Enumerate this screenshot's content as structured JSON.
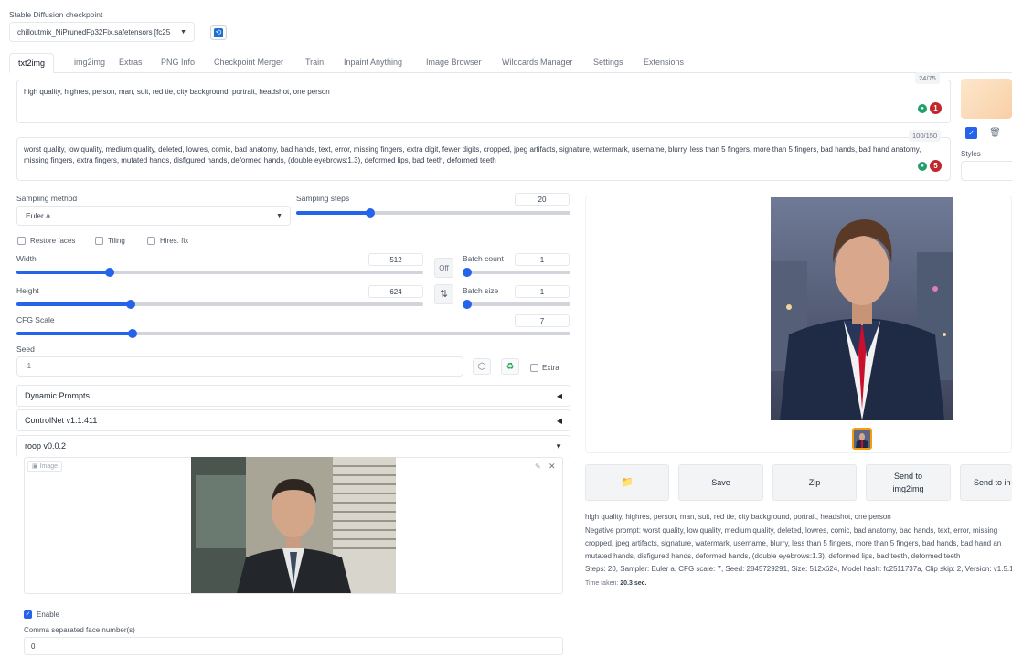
{
  "checkpoint": {
    "label": "Stable Diffusion checkpoint",
    "value": "chilloutmix_NiPrunedFp32Fix.safetensors [fc25"
  },
  "tabs": [
    "txt2img",
    "img2img",
    "Extras",
    "PNG Info",
    "Checkpoint Merger",
    "Train",
    "Inpaint Anything",
    "Image Browser",
    "Wildcards Manager",
    "Settings",
    "Extensions"
  ],
  "prompt": {
    "text": "high quality, highres, person, man, suit, red tie, city background, portrait, headshot, one person",
    "counter": "24/75",
    "badge": "1"
  },
  "negative_prompt": {
    "line1": "worst quality, low quality, medium quality, deleted, lowres, comic, bad anatomy, bad hands, text, error, missing fingers, extra digit, fewer digits, cropped, jpeg artifacts, signature, watermark, username, blurry, less than 5 fingers, more than 5 fingers, bad hands, bad hand anatomy,",
    "line2": "missing fingers, extra fingers, mutated hands, disfigured hands, deformed hands, (double eyebrows:1.3), deformed lips, bad teeth, deformed teeth",
    "counter": "100/150",
    "badge": "5"
  },
  "styles_label": "Styles",
  "sampling": {
    "method_label": "Sampling method",
    "method_value": "Euler a",
    "steps_label": "Sampling steps",
    "steps_value": "20",
    "steps_fraction": 0.27
  },
  "options": {
    "restore_faces": "Restore faces",
    "tiling": "Tiling",
    "hires_fix": "Hires. fix"
  },
  "size": {
    "width_label": "Width",
    "width_value": "512",
    "width_fraction": 0.23,
    "height_label": "Height",
    "height_value": "624",
    "height_fraction": 0.28,
    "off_label": "Off",
    "swap_icon": "⇅"
  },
  "batch": {
    "count_label": "Batch count",
    "count_value": "1",
    "size_label": "Batch size",
    "size_value": "1"
  },
  "cfg": {
    "label": "CFG Scale",
    "value": "7",
    "fraction": 0.21
  },
  "seed": {
    "label": "Seed",
    "value": "-1",
    "extra_label": "Extra"
  },
  "accordions": {
    "dynamic_prompts": "Dynamic Prompts",
    "controlnet": "ControlNet v1.1.411",
    "roop": "roop v0.0.2"
  },
  "roop": {
    "image_label": "Image",
    "enable_label": "Enable",
    "faces_label": "Comma separated face number(s)",
    "faces_value": "0"
  },
  "actions": {
    "save": "Save",
    "zip": "Zip",
    "send_img2img_line1": "Send to",
    "send_img2img_line2": "img2img",
    "send_inpaint": "Send to in"
  },
  "info": {
    "prompt": "high quality, highres, person, man, suit, red tie, city background, portrait, headshot, one person",
    "negative_line1": "Negative prompt: worst quality, low quality, medium quality, deleted, lowres, comic, bad anatomy, bad hands, text, error, missing",
    "negative_line2": "cropped, jpeg artifacts, signature, watermark, username, blurry, less than 5 fingers, more than 5 fingers, bad hands, bad hand an",
    "negative_line3": "mutated hands, disfigured hands, deformed hands, (double eyebrows:1.3), deformed lips, bad teeth, deformed teeth",
    "params": "Steps: 20, Sampler: Euler a, CFG scale: 7, Seed: 2845729291, Size: 512x624, Model hash: fc2511737a, Clip skip: 2, Version: v1.5.1",
    "time_label": "Time taken:",
    "time_value": "20.3 sec."
  },
  "colors": {
    "accent": "#2563eb",
    "tie": "#c8102e",
    "suit": "#1f2a44"
  }
}
